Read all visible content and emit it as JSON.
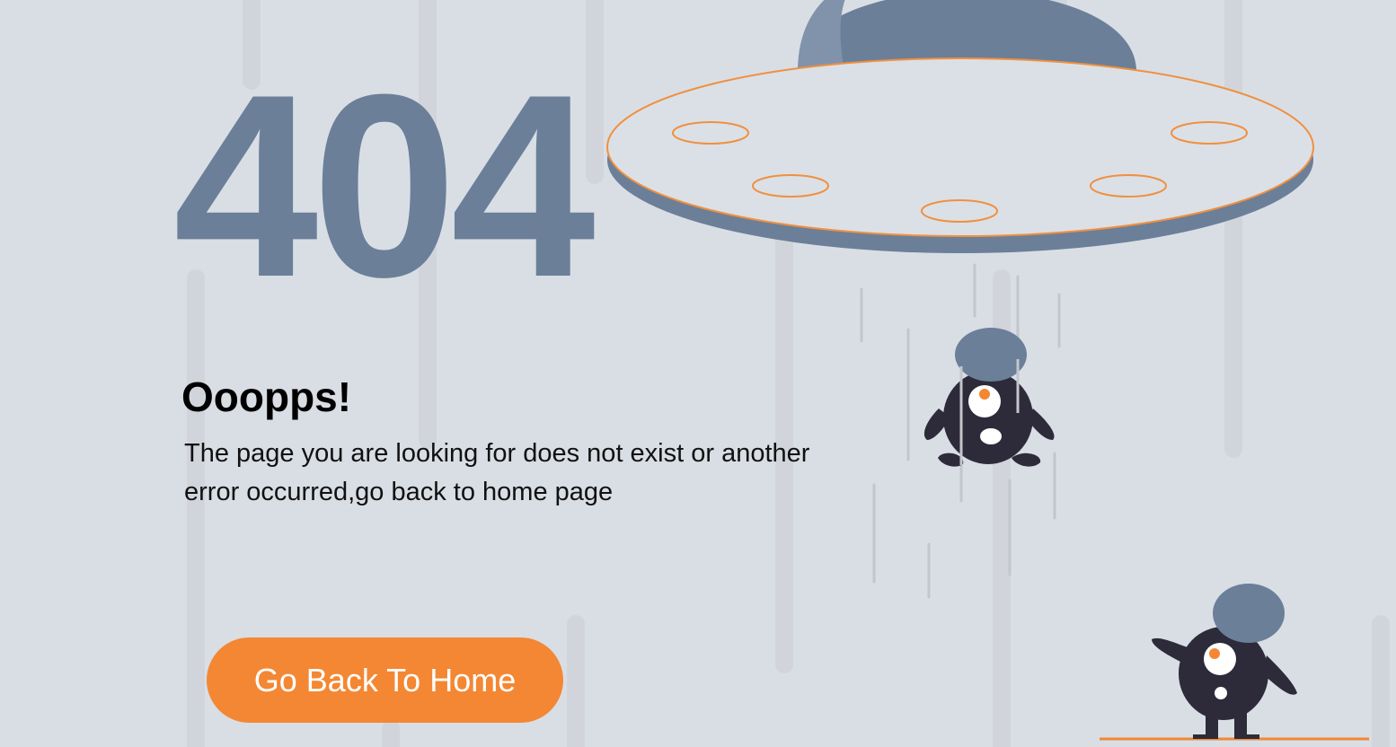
{
  "error": {
    "code": "404",
    "title": "Ooopps!",
    "message": "The page you are looking for does not exist or another error occurred,go back to home page"
  },
  "actions": {
    "home_button_label": "Go Back To Home"
  },
  "colors": {
    "background": "#d9dee5",
    "code": "#6b7f99",
    "accent": "#f48733",
    "ufo": "#6b7f99",
    "creature_body": "#2d2b3a",
    "rain_lines": "#c9ccd1"
  },
  "illustration": {
    "ufo": "ufo-illustration",
    "creatures": [
      "floating-creature",
      "pointing-creature"
    ]
  }
}
